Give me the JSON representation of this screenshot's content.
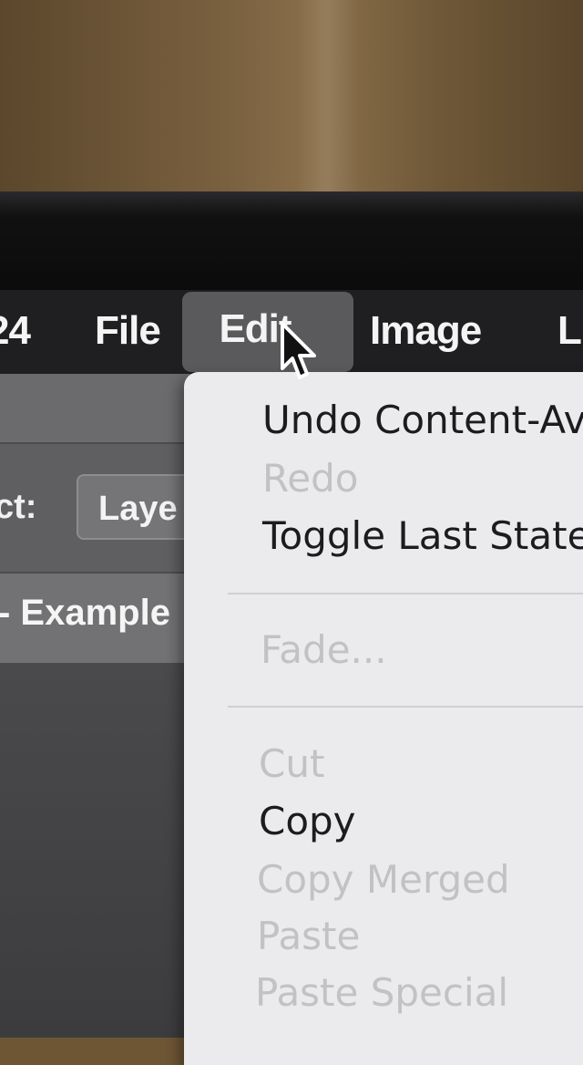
{
  "menubar": {
    "items": [
      {
        "label": "24"
      },
      {
        "label": "File"
      },
      {
        "label": "Edit",
        "active": true
      },
      {
        "label": "Image"
      },
      {
        "label": "L"
      }
    ]
  },
  "panel": {
    "select_label": "ct:",
    "select_value": "Laye",
    "document_title": "- Example"
  },
  "edit_menu": {
    "items": [
      {
        "label": "Undo Content-Av",
        "enabled": true
      },
      {
        "label": "Redo",
        "enabled": false
      },
      {
        "label": "Toggle Last State",
        "enabled": true
      },
      {
        "label": "Fade...",
        "enabled": false
      },
      {
        "label": "Cut",
        "enabled": false
      },
      {
        "label": "Copy",
        "enabled": true
      },
      {
        "label": "Copy Merged",
        "enabled": false
      },
      {
        "label": "Paste",
        "enabled": false
      },
      {
        "label": "Paste Special",
        "enabled": false
      }
    ]
  },
  "colors": {
    "menubar": "#1f1f21",
    "menu_highlight": "#5a5a5c",
    "dropdown_bg": "#ebebed",
    "enabled_text": "#1c1c1e",
    "disabled_text": "#c2c2c4"
  },
  "icons": {
    "cursor": "pointer-arrow-icon"
  }
}
